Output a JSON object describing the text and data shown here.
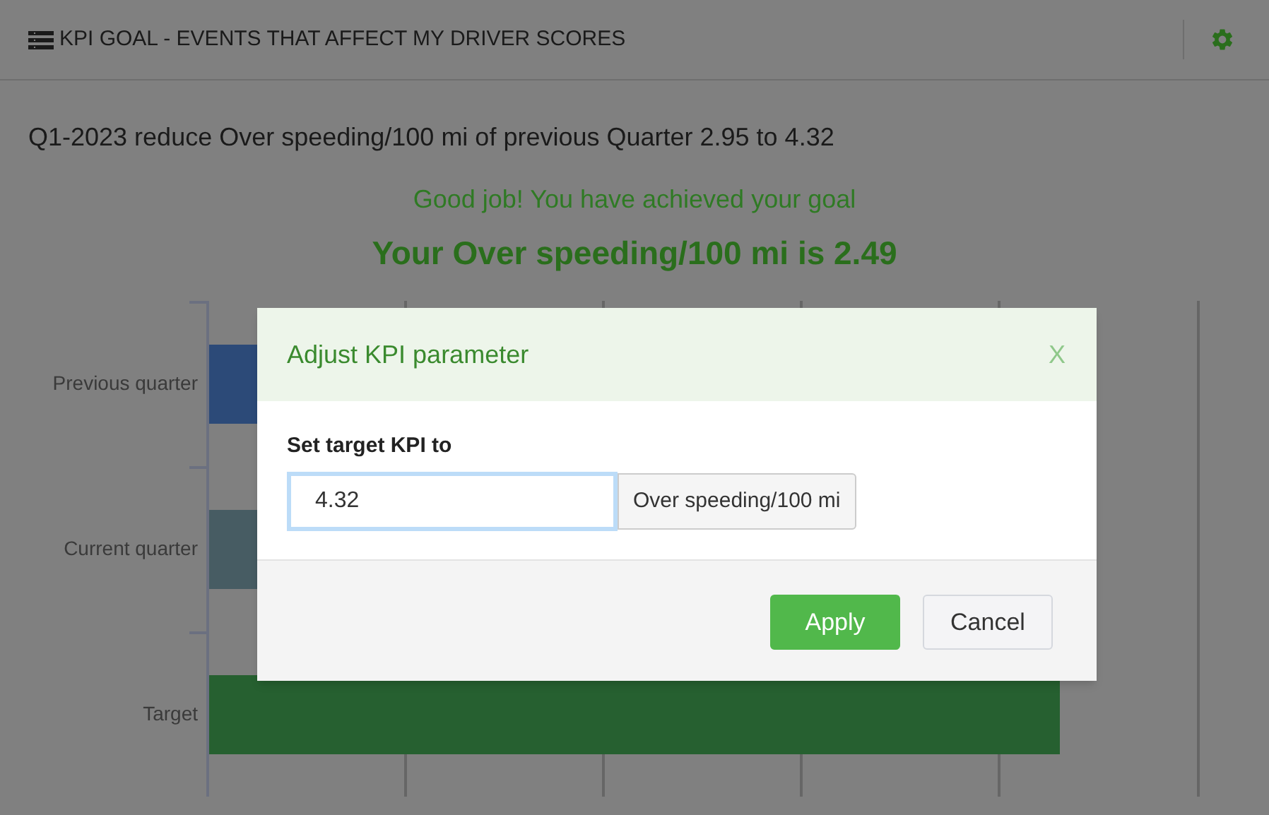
{
  "header": {
    "title": "KPI GOAL - EVENTS THAT AFFECT MY DRIVER SCORES"
  },
  "goal": "Q1-2023 reduce Over speeding/100 mi of previous Quarter 2.95 to 4.32",
  "message": "Good job! You have achieved your goal",
  "result": "Your Over speeding/100 mi is 2.49",
  "chart": {
    "categories": [
      {
        "label": "Previous quarter",
        "color": "#2c4a78"
      },
      {
        "label": "Current quarter",
        "color": "#475c63"
      },
      {
        "label": "Target",
        "color": "#266030"
      }
    ]
  },
  "modal": {
    "title": "Adjust KPI parameter",
    "close": "X",
    "field_label": "Set target KPI to",
    "value": "4.32",
    "unit": "Over speeding/100 mi",
    "buttons": [
      {
        "label": "Apply",
        "kind": "primary"
      },
      {
        "label": "Cancel",
        "kind": "default"
      }
    ]
  }
}
